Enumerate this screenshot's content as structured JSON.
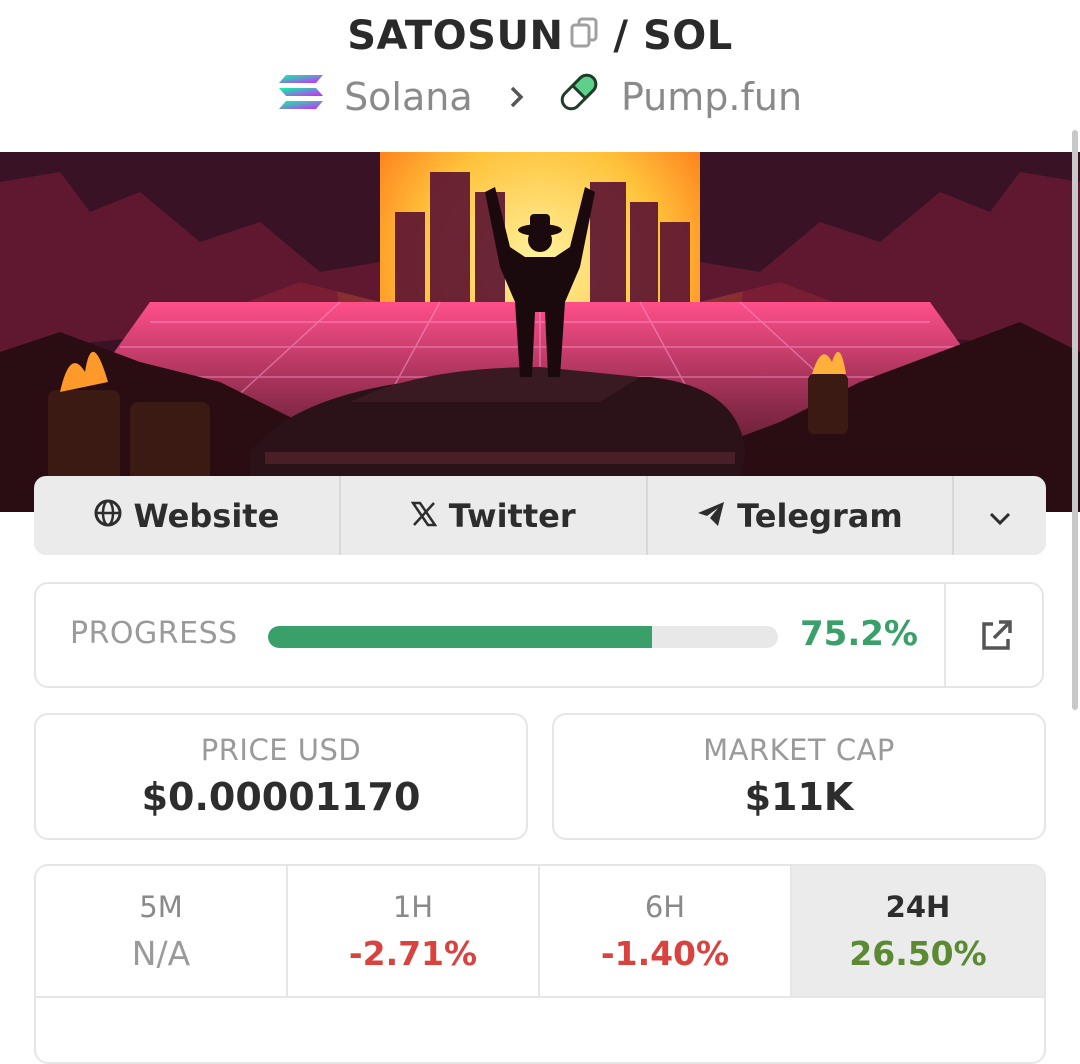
{
  "header": {
    "token": "SATOSUN",
    "separator": "/",
    "quote": "SOL",
    "chain": "Solana",
    "launchpad": "Pump.fun"
  },
  "links": {
    "website": "Website",
    "twitter": "Twitter",
    "telegram": "Telegram"
  },
  "progress": {
    "label": "PROGRESS",
    "value_text": "75.2%",
    "percent": 75.2
  },
  "stats": {
    "price": {
      "label": "PRICE USD",
      "value": "$0.00001170"
    },
    "market_cap": {
      "label": "MARKET CAP",
      "value": "$11K"
    }
  },
  "timeframes": [
    {
      "label": "5M",
      "value": "N/A"
    },
    {
      "label": "1H",
      "value": "-2.71%"
    },
    {
      "label": "6H",
      "value": "-1.40%"
    },
    {
      "label": "24H",
      "value": "26.50%"
    }
  ],
  "colors": {
    "positive": "#5b8a33",
    "negative": "#d8423f",
    "progress": "#3aa06a"
  },
  "icons": {
    "copy": "copy-icon",
    "solana": "solana-logo-icon",
    "pill": "pill-icon",
    "globe": "globe-icon",
    "x": "x-logo-icon",
    "telegram": "telegram-icon",
    "chevron": "chevron-down-icon",
    "external": "external-link-icon"
  }
}
